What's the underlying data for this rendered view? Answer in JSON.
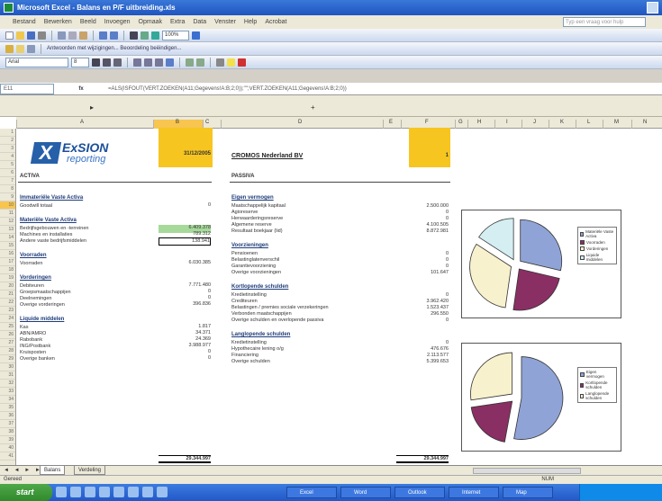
{
  "window": {
    "title": "Microsoft Excel - Balans en P/F uitbreiding.xls"
  },
  "menu": {
    "items": [
      "Bestand",
      "Bewerken",
      "Beeld",
      "Invoegen",
      "Opmaak",
      "Extra",
      "Data",
      "Venster",
      "Help",
      "Acrobat"
    ],
    "help_placeholder": "Typ een vraag voor hulp"
  },
  "toolbar": {
    "zoom": "100%",
    "reply_text": "Antwoorden met wijzigingen... Beoordeling beëindigen...",
    "font": "Arial",
    "font_size": "8"
  },
  "formula_bar": {
    "name_box": "E11",
    "formula": "=ALS(ISFOUT(VERT.ZOEKEN(A11;Gegevens!A:B;2;0));\"\";VERT.ZOEKEN(A11;Gegevens!A:B;2;0))"
  },
  "sheet": {
    "columns": [
      "A",
      "B",
      "C",
      "D",
      "E",
      "F",
      "G",
      "H",
      "I",
      "J",
      "K",
      "L",
      "M",
      "N"
    ],
    "selected_column": "B",
    "rows": [
      "1",
      "2",
      "3",
      "4",
      "5",
      "6",
      "7",
      "8",
      "9",
      "10",
      "11",
      "12",
      "13",
      "14",
      "15",
      "16",
      "17",
      "18",
      "19",
      "20",
      "21",
      "22",
      "23",
      "24",
      "25",
      "26",
      "27",
      "28",
      "29",
      "30",
      "31",
      "32",
      "33",
      "34",
      "35",
      "36",
      "37",
      "38",
      "39",
      "40",
      "41"
    ],
    "selected_row": "10"
  },
  "logo": {
    "mark": "X",
    "line1": "ExSION",
    "line2": "reporting"
  },
  "header": {
    "date": "31/12/2005",
    "company": "CROMOS Nederland BV",
    "index": "1"
  },
  "activa": {
    "title": "ACTIVA",
    "sections": [
      {
        "name": "Immateriële Vaste Activa",
        "rows": [
          {
            "label": "Goodwill totaal",
            "value": "0"
          }
        ]
      },
      {
        "name": "Materiële Vaste Activa",
        "rows": [
          {
            "label": "Bedrijfsgebouwen en -terreinen",
            "value": "6.409.378"
          },
          {
            "label": "Machines en installaties",
            "value": "789.312"
          },
          {
            "label": "Andere vaste bedrijfsmiddelen",
            "value": "138.941"
          }
        ]
      },
      {
        "name": "Voorraden",
        "rows": [
          {
            "label": "Voorraden",
            "value": "6.030.385"
          }
        ]
      },
      {
        "name": "Vorderingen",
        "rows": [
          {
            "label": "Debiteuren",
            "value": "7.771.480"
          },
          {
            "label": "Groepsmaatschappijen",
            "value": "0"
          },
          {
            "label": "Deelnemingen",
            "value": "0"
          },
          {
            "label": "Overige vorderingen",
            "value": "396.836"
          }
        ]
      },
      {
        "name": "Liquide middelen",
        "rows": [
          {
            "label": "Kas",
            "value": "1.817"
          },
          {
            "label": "ABN/AMRO",
            "value": "34.371"
          },
          {
            "label": "Rabobank",
            "value": "24.369"
          },
          {
            "label": "ING/Postbank",
            "value": "3.988.977"
          },
          {
            "label": "Kruisposten",
            "value": "0"
          },
          {
            "label": "Overige banken",
            "value": "0"
          }
        ]
      }
    ],
    "total": "29.344.997"
  },
  "passiva": {
    "title": "PASSIVA",
    "sections": [
      {
        "name": "Eigen vermogen",
        "rows": [
          {
            "label": "Maatschappelijk kapitaal",
            "value": "2.500.000"
          },
          {
            "label": "Agioreserve",
            "value": "0"
          },
          {
            "label": "Herwaarderingsreserve",
            "value": "0"
          },
          {
            "label": "Algemene reserve",
            "value": "4.100.505"
          },
          {
            "label": "Resultaat boekjaar (lid)",
            "value": "8.872.981"
          }
        ]
      },
      {
        "name": "Voorzieningen",
        "rows": [
          {
            "label": "Pensioenen",
            "value": "0"
          },
          {
            "label": "Belastinglatenverschil",
            "value": "0"
          },
          {
            "label": "Garantievoorziening",
            "value": "0"
          },
          {
            "label": "Overige voorzieningen",
            "value": "101.647"
          }
        ]
      },
      {
        "name": "Kortlopende schulden",
        "rows": [
          {
            "label": "Kredietinstelling",
            "value": "0"
          },
          {
            "label": "Crediteuren",
            "value": "3.962.420"
          },
          {
            "label": "Belastingen / premies sociale verzekeringen",
            "value": "1.523.437"
          },
          {
            "label": "Verbonden maatschappijen",
            "value": "296.550"
          },
          {
            "label": "Overige schulden en overlopende passiva",
            "value": "0"
          }
        ]
      },
      {
        "name": "Langlopende schulden",
        "rows": [
          {
            "label": "Kredietinstelling",
            "value": "0"
          },
          {
            "label": "Hypothecaire lening o/g",
            "value": "476.676"
          },
          {
            "label": "Financiering",
            "value": "2.113.577"
          },
          {
            "label": "Overige schulden",
            "value": "5.399.653"
          }
        ]
      }
    ],
    "total": "29.344.997"
  },
  "chart_data": [
    {
      "type": "pie",
      "categories": [
        "Materiële Vaste Activa",
        "Voorraden",
        "Vorderingen",
        "Liquide middelen"
      ],
      "values": [
        7337631,
        6030385,
        8168316,
        4049534
      ],
      "colors": [
        "#8fa3d6",
        "#8a2f63",
        "#f8f1cd",
        "#d4eef2"
      ]
    },
    {
      "type": "pie",
      "categories": [
        "Eigen vermogen",
        "Kortlopende schulden",
        "Langlopende schulden"
      ],
      "values": [
        15473486,
        5782407,
        7989906
      ],
      "colors": [
        "#8fa3d6",
        "#8a2f63",
        "#f8f1cd"
      ]
    }
  ],
  "legend_text": {
    "chart1": [
      "Materiële Vaste Activa",
      "Voorraden",
      "Vorderingen",
      "Liquide middelen"
    ],
    "chart2": [
      "Eigen vermogen",
      "Kortlopende schulden",
      "Langlopende schulden"
    ]
  },
  "tabs": {
    "nav": "◄ ◄ ► ►",
    "items": [
      "Balans",
      "Verdeling"
    ],
    "active": "Balans"
  },
  "status": {
    "text": "Gereed",
    "mode": "NUM"
  },
  "taskbar": {
    "start": "start",
    "tasks": [
      "Excel",
      "Word",
      "Outlook",
      "Internet",
      "Map"
    ]
  }
}
